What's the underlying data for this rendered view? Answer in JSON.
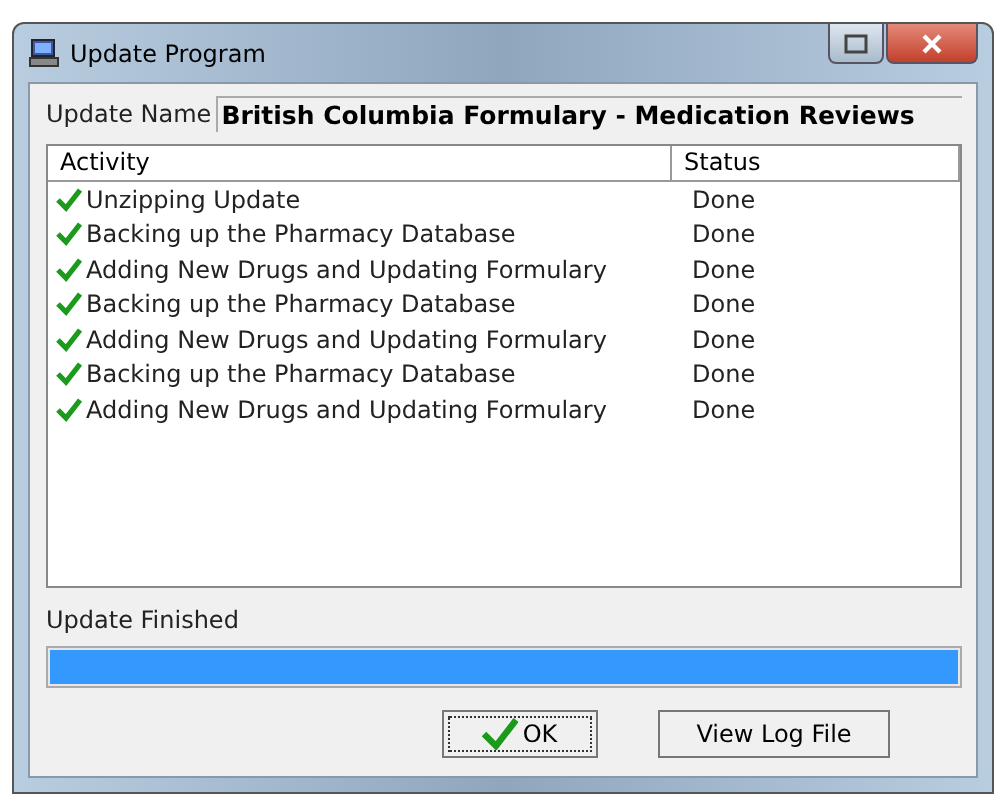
{
  "window": {
    "title": "Update Program"
  },
  "update_name": {
    "label": "Update Name",
    "value": "British Columbia Formulary - Medication Reviews"
  },
  "table": {
    "columns": [
      "Activity",
      "Status"
    ],
    "rows": [
      {
        "activity": "Unzipping Update",
        "status": "Done"
      },
      {
        "activity": "Backing up the Pharmacy Database",
        "status": "Done"
      },
      {
        "activity": "Adding New Drugs and Updating Formulary",
        "status": "Done"
      },
      {
        "activity": "Backing up the Pharmacy Database",
        "status": "Done"
      },
      {
        "activity": "Adding New Drugs and Updating Formulary",
        "status": "Done"
      },
      {
        "activity": "Backing up the Pharmacy Database",
        "status": "Done"
      },
      {
        "activity": "Adding New Drugs and Updating Formulary",
        "status": "Done"
      }
    ]
  },
  "progress": {
    "label": "Update Finished",
    "level": 1
  },
  "buttons": [
    {
      "label": "OK",
      "kind": "default"
    },
    {
      "label": "View Log File",
      "kind": "normal"
    }
  ]
}
